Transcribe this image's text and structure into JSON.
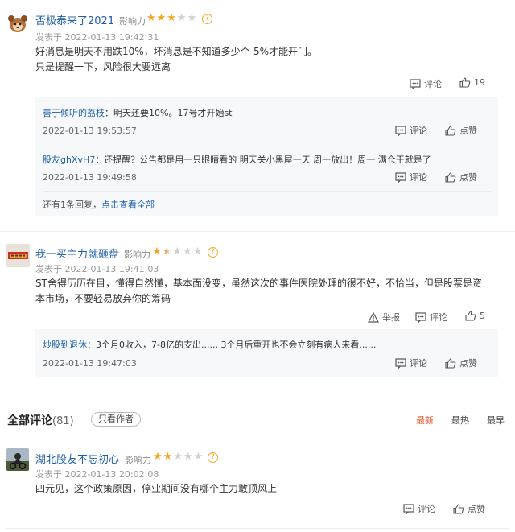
{
  "comments": [
    {
      "user": "否极泰来了2021",
      "influence_label": "影响力",
      "stars": 3,
      "time": "发表于 2022-01-13 19:42:31",
      "content_lines": [
        "好消息是明天不用跌10%，坏消息是不知道多少个-5%才能开门。",
        "只是提醒一下，风险很大要远离"
      ],
      "comment_label": "评论",
      "likes": "19",
      "replies": [
        {
          "user": "善于倾听的荔枝",
          "text": "：明天还要10%。17号才开始st",
          "time": "2022-01-13 19:53:57",
          "comment_label": "评论",
          "like_label": "点赞"
        },
        {
          "user": "股友ghXvH7",
          "text": "：还提醒？公告都是用一只眼睛看的 明天关小黑屋一天 周一放出！周一 满仓干就是了",
          "time": "2022-01-13 19:49:58",
          "comment_label": "评论",
          "like_label": "点赞"
        }
      ],
      "more_prefix": "还有1条回复，",
      "more_link": "点击查看全部"
    },
    {
      "user": "我一买主力就砸盘",
      "influence_label": "影响力",
      "stars": 1.5,
      "time": "发表于 2022-01-13 19:41:03",
      "content_lines": [
        "ST舍得历历在目，懂得自然懂，基本面没变，虽然这次的事件医院处理的很不好，不恰当，但是股票是资",
        "本市场，不要轻易放弃你的筹码"
      ],
      "report_label": "举报",
      "comment_label": "评论",
      "likes": "5",
      "replies": [
        {
          "user": "炒股到退休",
          "text": "：3个月0收入，7-8亿的支出...... 3个月后重开也不会立刻有病人来看......",
          "time": "2022-01-13 19:47:03",
          "comment_label": "评论",
          "like_label": "点赞"
        }
      ]
    }
  ],
  "section": {
    "title": "全部评论",
    "count": "(81)",
    "author_only": "只看作者",
    "sort": [
      "最新",
      "最热",
      "最早"
    ]
  },
  "comment3": {
    "user": "湖北股友不忘初心",
    "influence_label": "影响力",
    "stars": 2,
    "time": "发表于 2022-01-13 20:02:08",
    "content": "四元见，这个政策原因，停业期间没有哪个主力敢顶风上",
    "comment_label": "评论",
    "like_label": "点赞"
  },
  "colors": {
    "link": "#1d5ea8",
    "star": "#f5a623",
    "active_sort": "#e6532a"
  }
}
